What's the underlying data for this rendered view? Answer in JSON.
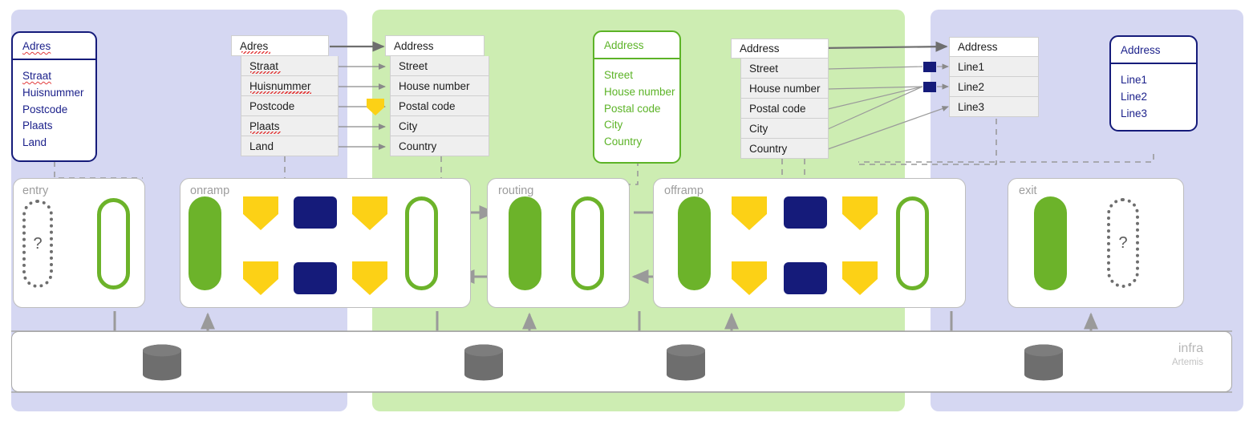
{
  "colors": {
    "panel_blue": "#d5d7f2",
    "panel_green": "#cdedb2",
    "navy": "#151b7a",
    "green": "#6cb32a",
    "yellow": "#fcd116",
    "gray_line": "#9a9a9a",
    "cylinder": "#6e6e6e"
  },
  "entities": {
    "source_nl": {
      "title": "Adres",
      "fields": [
        "Straat",
        "Huisnummer",
        "Postcode",
        "Plaats",
        "Land"
      ],
      "style": "navy"
    },
    "canonical_en": {
      "title": "Address",
      "fields": [
        "Street",
        "House  number",
        "Postal code",
        "City",
        "Country"
      ],
      "style": "green"
    },
    "target_lines": {
      "title": "Address",
      "fields": [
        "Line1",
        "Line2",
        "Line3"
      ],
      "style": "navy"
    }
  },
  "tables": {
    "adres_nl": {
      "header": "Adres",
      "rows": [
        "Straat",
        "Huisnummer",
        "Postcode",
        "Plaats",
        "Land"
      ]
    },
    "address_en": {
      "header": "Address",
      "rows": [
        "Street",
        "House number",
        "Postal code",
        "City",
        "Country"
      ]
    },
    "address_mid": {
      "header": "Address",
      "rows": [
        "Street",
        "House number",
        "Postal code",
        "City",
        "Country"
      ]
    },
    "address_lines": {
      "header": "Address",
      "rows": [
        "Line1",
        "Line2",
        "Line3"
      ]
    }
  },
  "lanes": [
    {
      "id": "entry",
      "label": "entry"
    },
    {
      "id": "onramp",
      "label": "onramp"
    },
    {
      "id": "routing",
      "label": "routing"
    },
    {
      "id": "offramp",
      "label": "offramp"
    },
    {
      "id": "exit",
      "label": "exit"
    }
  ],
  "infra": {
    "title": "infra",
    "subtitle": "Artemis"
  },
  "unknown_marker": "?"
}
